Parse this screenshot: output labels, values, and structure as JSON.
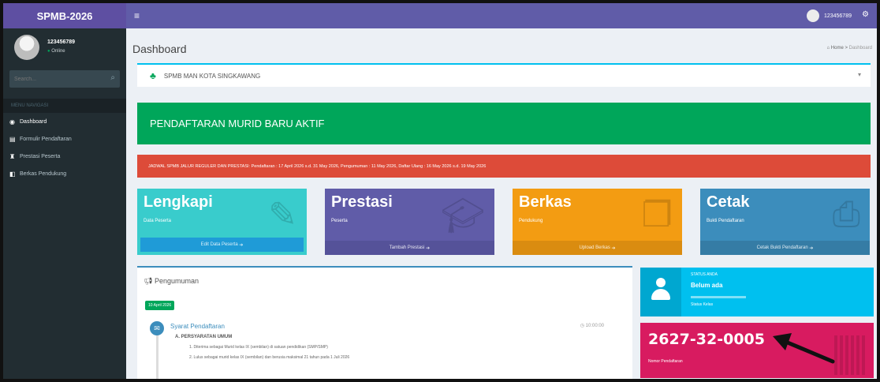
{
  "app": {
    "title": "SPMB-2026"
  },
  "sidebar": {
    "user_name": "123456789",
    "user_status": "Online",
    "search_placeholder": "Search...",
    "menu_header": "MENU NAVIGASI",
    "items": [
      {
        "label": "Dashboard",
        "icon": "dashboard-icon"
      },
      {
        "label": "Formulir Pendaftaran",
        "icon": "file-icon"
      },
      {
        "label": "Prestasi Peserta",
        "icon": "trophy-icon"
      },
      {
        "label": "Berkas Pendukung",
        "icon": "folder-icon"
      }
    ]
  },
  "topbar": {
    "user_name": "123456789"
  },
  "content": {
    "title": "Dashboard",
    "breadcrumb": {
      "home": "Home",
      "current": "Dashboard"
    }
  },
  "school": {
    "name": "SPMB MAN KOTA SINGKAWANG"
  },
  "banners": {
    "active": "PENDAFTARAN MURID BARU AKTIF",
    "schedule": "JADWAL SPMB JALUR REGULER DAN PRESTASI: Pendaftaran : 17 April 2026 s.d. 31 May 2026, Pengumuman : 11 May 2026, Daftar Ulang : 16 May 2026 s.d. 19 May 2026"
  },
  "boxes": [
    {
      "title": "Lengkapi",
      "subtitle": "Data Peserta",
      "footer": "Edit Data Peserta",
      "icon": "edit-icon"
    },
    {
      "title": "Prestasi",
      "subtitle": "Peserta",
      "footer": "Tambah Prestasi",
      "icon": "graduation-icon"
    },
    {
      "title": "Berkas",
      "subtitle": "Pendukung",
      "footer": "Upload Berkas",
      "icon": "files-icon"
    },
    {
      "title": "Cetak",
      "subtitle": "Bukti Pendaftaran",
      "footer": "Cetak Bukti Pendaftaran",
      "icon": "printer-icon"
    }
  ],
  "announcement": {
    "title": "Pengumuman",
    "date": "10 April 2026",
    "item_title": "Syarat Pendaftaran",
    "item_time": "10:00:00",
    "section": "A.  PERSYARATAN UMUM",
    "lines": [
      "1. Diterima sebagai Murid kelas IX (sembilan) di satuan pendidikan (SMP/SMP)",
      "2. Lulus sebagai murid kelas IX (sembilan) dan berusia maksimal 21 tahun pada 1 Juli 2026"
    ]
  },
  "status": {
    "label": "STATUS ANDA",
    "value": "Belum ada",
    "desc": "Status Kelas"
  },
  "registration": {
    "number": "2627-32-0005",
    "label": "Nomor Pendaftaran"
  },
  "colors": {
    "header": "#605ca8",
    "sidebar": "#222d32",
    "green": "#00a65a",
    "red": "#dd4b39",
    "teal": "#39cccc",
    "purple": "#605ca8",
    "orange": "#f39c12",
    "blue": "#3c8dbc",
    "aqua": "#00c0ef",
    "maroon": "#d81b60"
  }
}
